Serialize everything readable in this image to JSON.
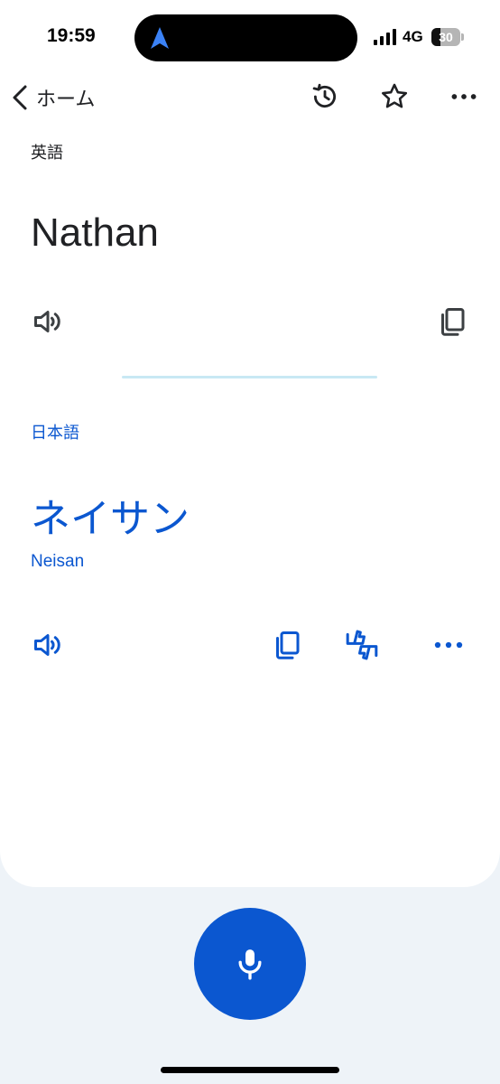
{
  "status_bar": {
    "time": "19:59",
    "network": "4G",
    "battery": "30",
    "battery_fraction": 0.3
  },
  "top_bar": {
    "back_label": "ホーム",
    "icons": [
      "back-chevron-icon",
      "history-icon",
      "star-icon",
      "more-horizontal-icon"
    ]
  },
  "source": {
    "language": "英語",
    "text": "Nathan"
  },
  "target": {
    "language": "日本語",
    "text": "ネイサン",
    "romanization": "Neisan"
  },
  "colors": {
    "accent": "#0b57d0",
    "divider": "#c8e8f4",
    "background": "#eef3f8",
    "card": "#ffffff"
  }
}
